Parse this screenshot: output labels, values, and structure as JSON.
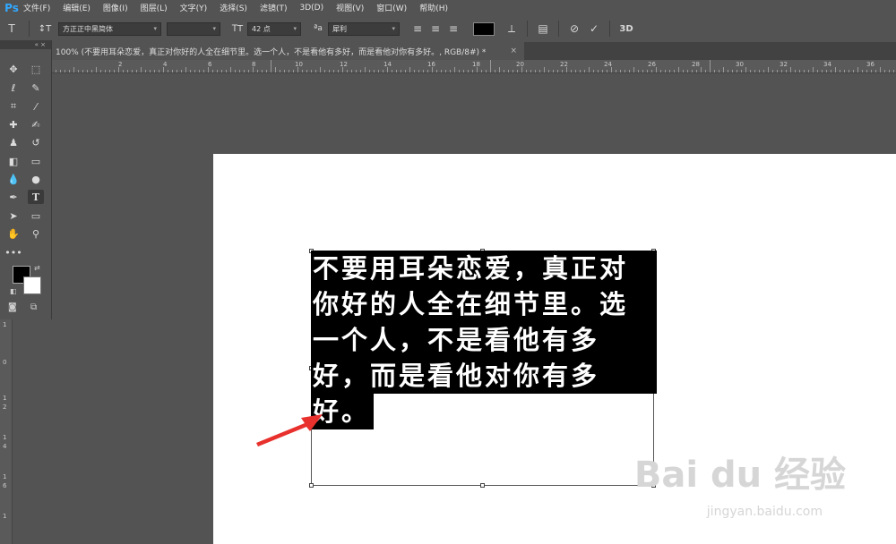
{
  "app": {
    "logo": "Ps"
  },
  "menu": [
    "文件(F)",
    "编辑(E)",
    "图像(I)",
    "图层(L)",
    "文字(Y)",
    "选择(S)",
    "滤镜(T)",
    "3D(D)",
    "视图(V)",
    "窗口(W)",
    "帮助(H)"
  ],
  "options": {
    "font_family": "方正正中黑简体",
    "font_size": "42 点",
    "aa_label": "ªa",
    "anti_alias": "犀利",
    "label_3d": "3D"
  },
  "document": {
    "tab_title": "100% (不要用耳朵恋爱，真正对你好的人全在细节里。选一个人，不是看他有多好，而是看他对你有多好。, RGB/8#) *",
    "close": "×"
  },
  "ruler_top": [
    "2",
    "4",
    "6",
    "8",
    "10",
    "12",
    "14",
    "16",
    "18",
    "20",
    "22",
    "24",
    "26",
    "28",
    "30",
    "32",
    "34",
    "36",
    "38"
  ],
  "ruler_left": [
    "1",
    "0",
    "1",
    "2",
    "1",
    "4",
    "1",
    "6",
    "1"
  ],
  "text_lines": [
    "不要用耳朵恋爱，真正对",
    "你好的人全在细节里。选",
    "一个人，不是看他有多",
    "好，而是看他对你有多",
    "好。"
  ],
  "watermark": {
    "main": "Bai du 经验",
    "sub": "jingyan.baidu.com"
  },
  "colors": {
    "foreground": "#000000",
    "background": "#ffffff",
    "arrow": "#e8302c",
    "brand": "#31a8ff"
  },
  "icons": {
    "type_tool": "T",
    "orientation": "↕T",
    "size": "ꓔT",
    "align_left": "≡",
    "align_center": "≡",
    "align_right": "≡",
    "warp": "⟂",
    "panels": "▤",
    "cancel": "⊘",
    "commit": "✓"
  }
}
